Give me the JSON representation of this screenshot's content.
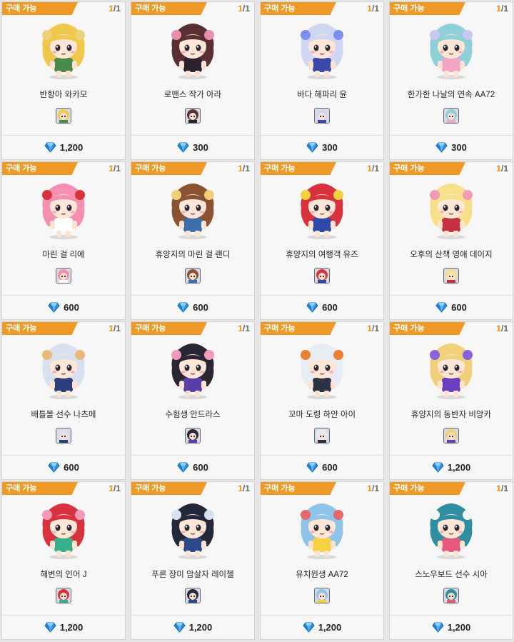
{
  "shop": {
    "status_label": "구매 가능",
    "currency_icon": "blue-gem-icon",
    "items": [
      {
        "name": "반항아 와카모",
        "price": "1,200",
        "stock_left": "1",
        "stock_total": "1",
        "hair": "#f0c94c",
        "outfit": "#4a8a4c",
        "accent": "#e9d27a"
      },
      {
        "name": "로맨스 작가 아라",
        "price": "300",
        "stock_left": "1",
        "stock_total": "1",
        "hair": "#5a2f34",
        "outfit": "#2b2230",
        "accent": "#e98fb0"
      },
      {
        "name": "바다 해파리 윤",
        "price": "300",
        "stock_left": "1",
        "stock_total": "1",
        "hair": "#cfd6f2",
        "outfit": "#3b49a8",
        "accent": "#7c8ff0"
      },
      {
        "name": "한가한 나날의 연속 AA72",
        "price": "300",
        "stock_left": "1",
        "stock_total": "1",
        "hair": "#8fd0d8",
        "outfit": "#f3a5c4",
        "accent": "#c8c9ef"
      },
      {
        "name": "마린 걸 리에",
        "price": "600",
        "stock_left": "1",
        "stock_total": "1",
        "hair": "#f58fb0",
        "outfit": "#ffffff",
        "accent": "#d8323e"
      },
      {
        "name": "휴양지의 마린 걸 랜디",
        "price": "600",
        "stock_left": "1",
        "stock_total": "1",
        "hair": "#8a5332",
        "outfit": "#3b6fa8",
        "accent": "#f1d07a"
      },
      {
        "name": "휴양지의 여행객 유즈",
        "price": "600",
        "stock_left": "1",
        "stock_total": "1",
        "hair": "#d8323e",
        "outfit": "#2e4aa8",
        "accent": "#f5d340"
      },
      {
        "name": "오후의 산책 영애 데이지",
        "price": "600",
        "stock_left": "1",
        "stock_total": "1",
        "hair": "#f6e08a",
        "outfit": "#c7303f",
        "accent": "#f29ab8"
      },
      {
        "name": "배틀볼 선수 나츠메",
        "price": "600",
        "stock_left": "1",
        "stock_total": "1",
        "hair": "#d9e1f1",
        "outfit": "#2d3f7a",
        "accent": "#e7b97c"
      },
      {
        "name": "수험생 안드라스",
        "price": "600",
        "stock_left": "1",
        "stock_total": "1",
        "hair": "#2a2633",
        "outfit": "#5a3fa8",
        "accent": "#f29ab8"
      },
      {
        "name": "꼬마 도령 하얀 아이",
        "price": "600",
        "stock_left": "1",
        "stock_total": "1",
        "hair": "#e6ecf4",
        "outfit": "#2c3344",
        "accent": "#e98234"
      },
      {
        "name": "휴양지의 동반자 비앙카",
        "price": "1,200",
        "stock_left": "1",
        "stock_total": "1",
        "hair": "#f1d07a",
        "outfit": "#6a3fc0",
        "accent": "#8a5fe0"
      },
      {
        "name": "해변의 인어 J",
        "price": "1,200",
        "stock_left": "1",
        "stock_total": "1",
        "hair": "#d8323e",
        "outfit": "#38b08c",
        "accent": "#f29ab8"
      },
      {
        "name": "푸른 장미 암살자 레이첼",
        "price": "1,200",
        "stock_left": "1",
        "stock_total": "1",
        "hair": "#23283a",
        "outfit": "#2c4a8a",
        "accent": "#d9e1f1"
      },
      {
        "name": "유치원생 AA72",
        "price": "1,200",
        "stock_left": "1",
        "stock_total": "1",
        "hair": "#8fc4e8",
        "outfit": "#f5d340",
        "accent": "#e5686a"
      },
      {
        "name": "스노우보드 선수 시아",
        "price": "1,200",
        "stock_left": "1",
        "stock_total": "1",
        "hair": "#2f8fa0",
        "outfit": "#e55a7c",
        "accent": "#f5f5f5"
      }
    ]
  }
}
